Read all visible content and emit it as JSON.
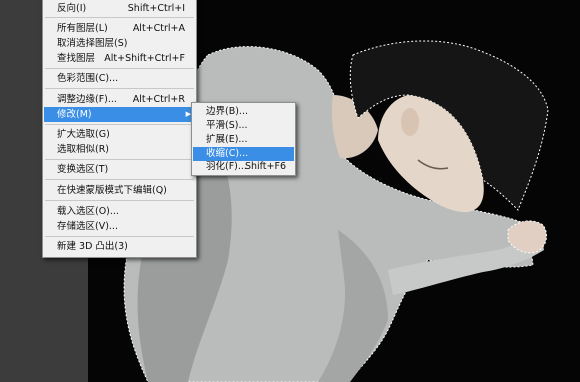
{
  "menu": {
    "items": [
      {
        "label": "反向(I)",
        "shortcut": "Shift+Ctrl+I"
      },
      {
        "label": "所有图层(L)",
        "shortcut": "Alt+Ctrl+A"
      },
      {
        "label": "取消选择图层(S)",
        "shortcut": ""
      },
      {
        "label": "查找图层",
        "shortcut": "Alt+Shift+Ctrl+F"
      },
      {
        "label": "色彩范围(C)...",
        "shortcut": ""
      },
      {
        "label": "调整边缘(F)...",
        "shortcut": "Alt+Ctrl+R"
      },
      {
        "label": "修改(M)",
        "shortcut": ""
      },
      {
        "label": "扩大选取(G)",
        "shortcut": ""
      },
      {
        "label": "选取相似(R)",
        "shortcut": ""
      },
      {
        "label": "变换选区(T)",
        "shortcut": ""
      },
      {
        "label": "在快速蒙版模式下编辑(Q)",
        "shortcut": ""
      },
      {
        "label": "载入选区(O)...",
        "shortcut": ""
      },
      {
        "label": "存储选区(V)...",
        "shortcut": ""
      },
      {
        "label": "新建 3D 凸出(3)",
        "shortcut": ""
      }
    ]
  },
  "submenu": {
    "items": [
      {
        "label": "边界(B)...",
        "shortcut": ""
      },
      {
        "label": "平滑(S)...",
        "shortcut": ""
      },
      {
        "label": "扩展(E)...",
        "shortcut": ""
      },
      {
        "label": "收缩(C)...",
        "shortcut": ""
      },
      {
        "label": "羽化(F)...",
        "shortcut": "Shift+F6"
      }
    ]
  },
  "colors": {
    "highlight": "#3a8ee6",
    "canvas": "#050505",
    "menu_bg": "#f0f0f0"
  }
}
